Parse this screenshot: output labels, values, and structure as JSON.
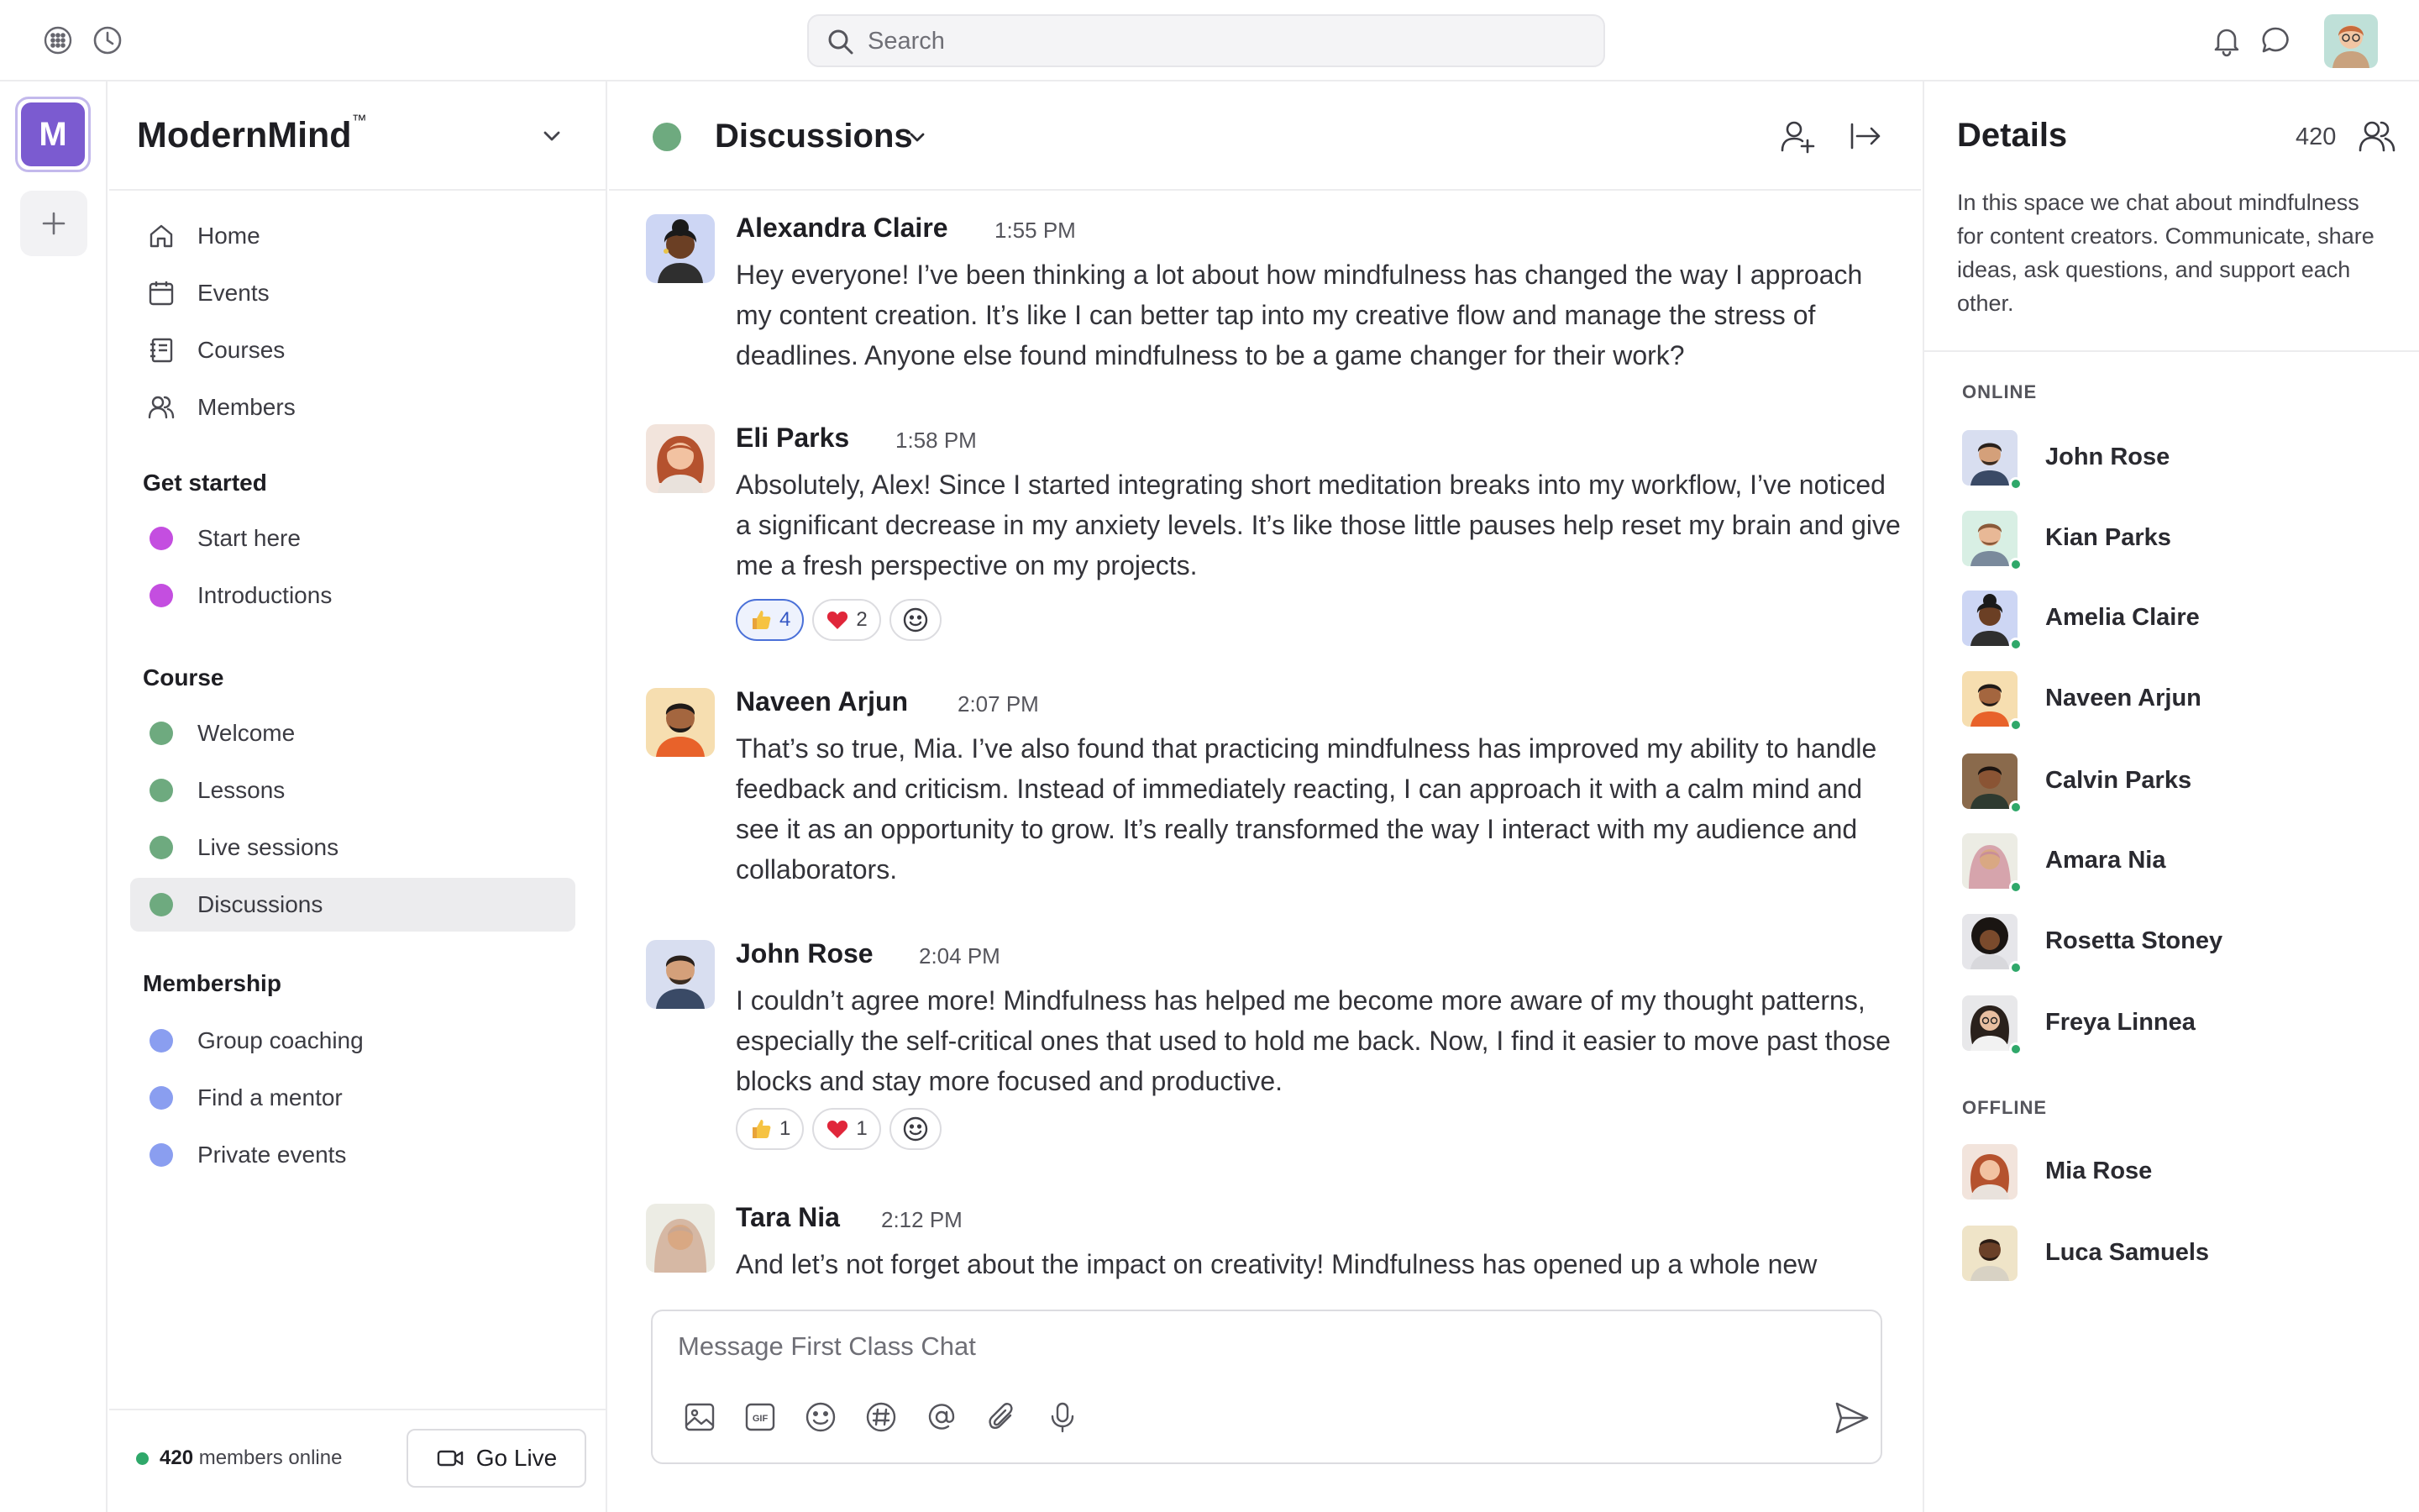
{
  "topbar": {
    "search_placeholder": "Search"
  },
  "rail": {
    "space_initial": "M",
    "colors": {
      "space_tile": "#7b5bd0"
    }
  },
  "sidebar": {
    "space_name": "ModernMind",
    "space_trademark": "™",
    "nav": [
      {
        "label": "Home",
        "icon": "home-icon"
      },
      {
        "label": "Events",
        "icon": "calendar-icon"
      },
      {
        "label": "Courses",
        "icon": "courses-icon"
      },
      {
        "label": "Members",
        "icon": "members-icon"
      }
    ],
    "sections": [
      {
        "title": "Get started",
        "items": [
          {
            "label": "Start here",
            "color": "#c44ee0"
          },
          {
            "label": "Introductions",
            "color": "#c44ee0"
          }
        ]
      },
      {
        "title": "Course",
        "items": [
          {
            "label": "Welcome",
            "color": "#6eaa7f"
          },
          {
            "label": "Lessons",
            "color": "#6eaa7f"
          },
          {
            "label": "Live sessions",
            "color": "#6eaa7f"
          },
          {
            "label": "Discussions",
            "color": "#6eaa7f",
            "active": true
          }
        ]
      },
      {
        "title": "Membership",
        "items": [
          {
            "label": "Group coaching",
            "color": "#8a9ef0"
          },
          {
            "label": "Find a mentor",
            "color": "#8a9ef0"
          },
          {
            "label": "Private events",
            "color": "#8a9ef0"
          }
        ]
      }
    ],
    "footer": {
      "online_count": "420",
      "online_suffix": " members online",
      "go_live_label": "Go Live"
    }
  },
  "channel": {
    "title": "Discussions",
    "dot_color": "#6eaa7f"
  },
  "messages": [
    {
      "author": "Alexandra Claire",
      "time": "1:55 PM",
      "text": "Hey everyone! I’ve been thinking a lot about how mindfulness has changed the way I approach my content creation. It’s like I can better tap into my creative flow and manage the stress of deadlines. Anyone else found mindfulness to be a game changer for their work?",
      "reactions": []
    },
    {
      "author": "Eli Parks",
      "time": "1:58 PM",
      "text": "Absolutely, Alex! Since I started integrating short meditation breaks into my workflow, I’ve noticed a significant decrease in my anxiety levels. It’s like those little pauses help reset my brain and give me a fresh perspective on my projects.",
      "reactions": [
        {
          "emoji": "thumbs-up",
          "count": "4",
          "mine": true
        },
        {
          "emoji": "heart",
          "count": "2",
          "mine": false
        }
      ]
    },
    {
      "author": "Naveen Arjun",
      "time": "2:07 PM",
      "text": "That’s so true, Mia. I’ve also found that practicing mindfulness has improved my ability to handle feedback and criticism. Instead of immediately reacting, I can approach it with a calm mind and see it as an opportunity to grow. It’s really transformed the way I interact with my audience and collaborators.",
      "reactions": []
    },
    {
      "author": "John Rose",
      "time": "2:04 PM",
      "text": "I couldn’t agree more! Mindfulness has helped me become more aware of my thought patterns, especially the self-critical ones that used to hold me back. Now, I find it easier to move past those blocks and stay more focused and productive.",
      "reactions": [
        {
          "emoji": "thumbs-up",
          "count": "1",
          "mine": false
        },
        {
          "emoji": "heart",
          "count": "1",
          "mine": false
        }
      ]
    },
    {
      "author": "Tara Nia",
      "time": "2:12 PM",
      "text": "And let’s not forget about the impact on creativity! Mindfulness has opened up a whole new",
      "reactions": []
    }
  ],
  "composer": {
    "placeholder": "Message First Class Chat",
    "tools": [
      "image-icon",
      "gif-icon",
      "emoji-icon",
      "hashtag-icon",
      "mention-icon",
      "attach-icon",
      "microphone-icon"
    ]
  },
  "details": {
    "title": "Details",
    "member_count": "420",
    "description": "In this space we chat about mindfulness for content creators. Communicate, share ideas, ask questions, and support each other.",
    "online_label": "ONLINE",
    "offline_label": "OFFLINE",
    "online": [
      "John Rose",
      "Kian Parks",
      "Amelia Claire",
      "Naveen Arjun",
      "Calvin Parks",
      "Amara Nia",
      "Rosetta Stoney",
      "Freya Linnea"
    ],
    "offline": [
      "Mia Rose",
      "Luca Samuels"
    ]
  },
  "colors": {
    "online_status": "#2fa86a",
    "reaction_mine": "#4a70d8"
  }
}
